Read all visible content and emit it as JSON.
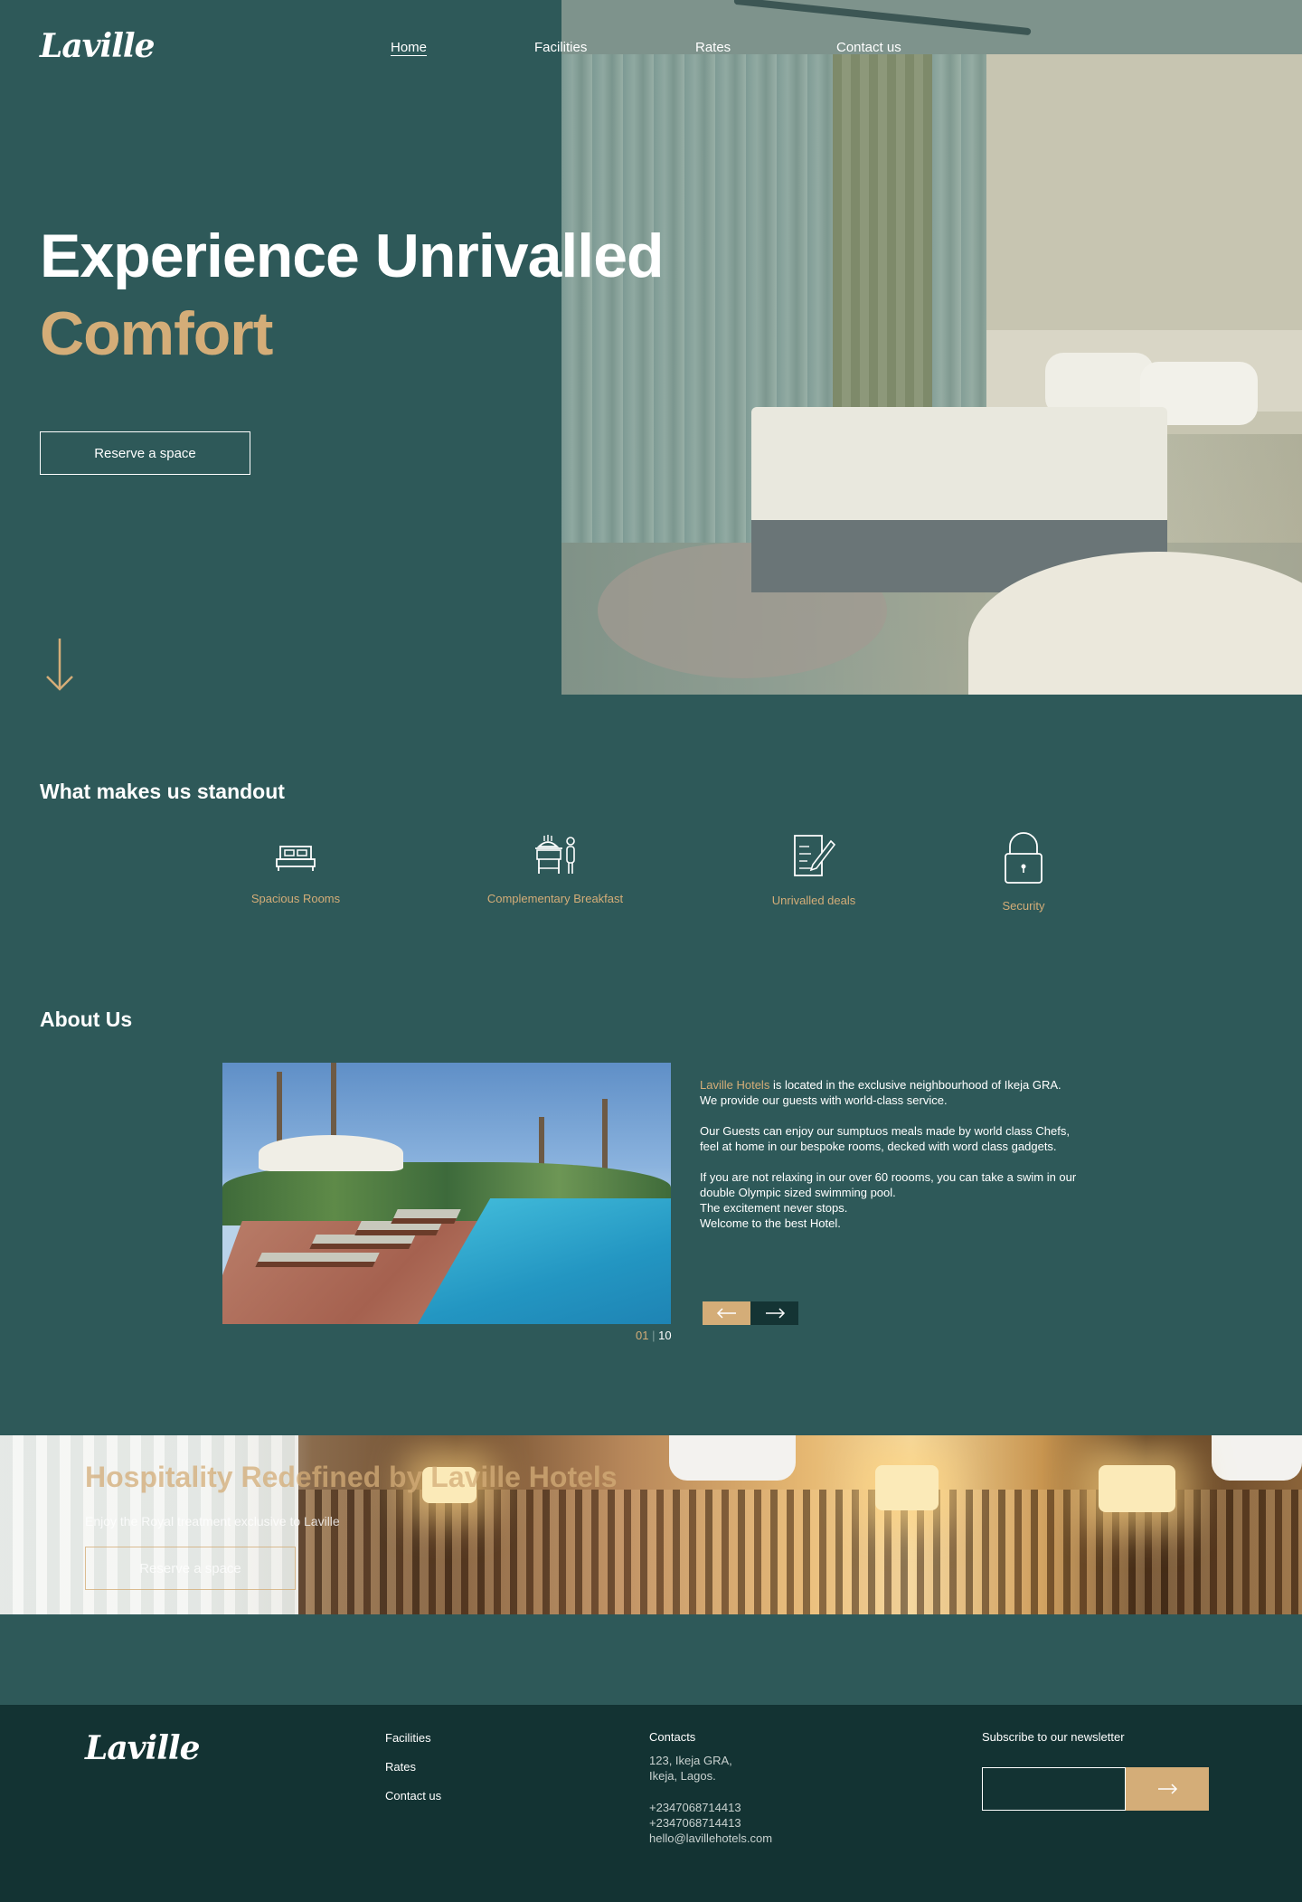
{
  "brand": {
    "logo": "Laville"
  },
  "nav": {
    "items": [
      "Home",
      "Facilities",
      "Rates",
      "Contact us"
    ],
    "active": "Home"
  },
  "hero": {
    "title_line1": "Experience Unrivalled",
    "title_line2": "Comfort",
    "cta": "Reserve a space"
  },
  "standout": {
    "title": "What makes us standout",
    "features": [
      {
        "label": "Spacious Rooms",
        "icon": "bed-icon"
      },
      {
        "label": "Complementary Breakfast",
        "icon": "breakfast-service-icon"
      },
      {
        "label": "Unrivalled deals",
        "icon": "document-pen-icon"
      },
      {
        "label": "Security",
        "icon": "padlock-icon"
      }
    ]
  },
  "about": {
    "title": "About Us",
    "highlight": "Laville Hotels",
    "p1_rest": " is located in the exclusive neighbourhood of Ikeja GRA.",
    "p1_line2": "We provide our guests with world-class service.",
    "p2": "Our Guests can enjoy our sumptuos meals made by world class Chefs, feel at home in our bespoke rooms, decked with word class gadgets.",
    "p3_line1": "If you are not relaxing in our over 60 roooms, you can take a swim in our double Olympic sized swimming pool.",
    "p3_line2": "The excitement never stops.",
    "p3_line3": "Welcome to the best Hotel.",
    "counter_current": "01",
    "counter_sep": "|",
    "counter_total": "10"
  },
  "banner": {
    "title": "Hospitality Redefined by Laville Hotels",
    "subtitle": "Enjoy the Royal treatment exclusive to Laville",
    "cta": "Reserve a space"
  },
  "footer": {
    "logo": "Laville",
    "links": [
      "Facilities",
      "Rates",
      "Contact us"
    ],
    "contacts_title": "Contacts",
    "address_line1": "123, Ikeja GRA,",
    "address_line2": "Ikeja, Lagos.",
    "phone1": "+2347068714413",
    "phone2": "+2347068714413",
    "email": "hello@lavillehotels.com",
    "newsletter_title": "Subscribe to our newsletter"
  },
  "colors": {
    "background": "#2e5959",
    "accent": "#d4ad78",
    "footer": "#133333",
    "next_button": "#143434"
  }
}
